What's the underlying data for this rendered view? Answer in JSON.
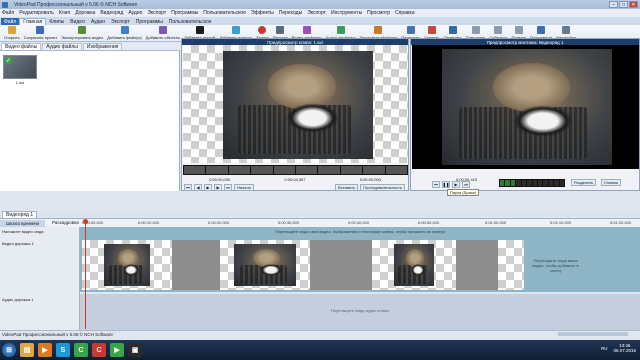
{
  "window": {
    "title": "VideoPad Профессиональный v 5.06 © NCH Software"
  },
  "menu": [
    "Файл",
    "Редактировать",
    "Клип",
    "Дорожка",
    "Видеоряд",
    "Аудио",
    "Экспорт",
    "Программы",
    "Пользовательское",
    "Эффекты",
    "Переходы",
    "Экспорт",
    "Инструменты",
    "Просмотр",
    "Справка"
  ],
  "ribbon_tabs": [
    "Файл",
    "Главная",
    "Клипы",
    "Видео",
    "Аудио",
    "Экспорт",
    "Программы",
    "Пользовательское"
  ],
  "ribbon_buttons": [
    {
      "label": "Открыть",
      "icon": "folder-icon",
      "color": "#d8a636"
    },
    {
      "label": "Сохранить проект",
      "icon": "save-icon",
      "color": "#3b6db0"
    },
    {
      "label": "Экспортировать видео",
      "icon": "export-icon",
      "color": "#5a8c3a"
    },
    {
      "label": "Добавить файл(ы)",
      "icon": "add-file-icon",
      "color": "#3d7fc9"
    },
    {
      "label": "Добавить объекты",
      "icon": "add-objects-icon",
      "color": "#7a5bb0"
    },
    {
      "label": "Добавить пустой",
      "icon": "blank-clip-icon",
      "color": "#1b1b1b"
    },
    {
      "label": "Добавить плашку",
      "icon": "title-icon",
      "color": "#3aa0c9"
    },
    {
      "label": "Запись",
      "icon": "record-icon",
      "color": "#c93b32"
    },
    {
      "label": "Рассказ",
      "icon": "narrate-icon",
      "color": "#5b6b80"
    },
    {
      "label": "Видео эффекты",
      "icon": "video-effects-icon",
      "color": "#9c4fb6"
    },
    {
      "label": "Аудио эффекты",
      "icon": "audio-effects-icon",
      "color": "#3b9c5e"
    },
    {
      "label": "Текстовые эффекты",
      "icon": "text-effects-icon",
      "color": "#c77a2e"
    },
    {
      "label": "Переходы",
      "icon": "transitions-icon",
      "color": "#4673b0"
    },
    {
      "label": "Удалить",
      "icon": "delete-icon",
      "color": "#c24a3c"
    },
    {
      "label": "Отменить",
      "icon": "undo-icon",
      "color": "#3467a8"
    },
    {
      "label": "Повторить",
      "icon": "redo-icon",
      "color": "#8a9bb0"
    },
    {
      "label": "Субтитры",
      "icon": "subtitles-icon",
      "color": "#8a9bb0"
    },
    {
      "label": "Пример",
      "icon": "preview-icon",
      "color": "#8a9bb0"
    },
    {
      "label": "Поделиться",
      "icon": "share-icon",
      "color": "#3b6db0"
    },
    {
      "label": "Настройки",
      "icon": "settings-icon",
      "color": "#6a7a8e"
    }
  ],
  "bin": {
    "tabs": [
      "Видео файлы",
      "Аудио файлы",
      "Изображения"
    ],
    "clip_label": "1.avi"
  },
  "clip_preview": {
    "title": "Предпросмотр клипа: 1.avi",
    "times": [
      "0:00:00,000",
      "0:00:04,967",
      "0:00:00,000"
    ],
    "buttons": {
      "start": "Начало",
      "insert": "Вставить",
      "seq": "Последовательность"
    }
  },
  "seq_preview": {
    "title": "Предпросмотр монтажа: Видеоряд 1",
    "time": "0:00:00,415",
    "tooltip": "Пауза (Space)",
    "right_buttons": [
      "Разделить",
      "Снимок"
    ]
  },
  "timeline": {
    "tab": "Видеоряд 1",
    "subtabs": [
      "Шкала времени",
      "Раскадровка"
    ],
    "ruler": [
      "0:00:00,000",
      "0:00:10,000",
      "0:00:20,000",
      "0:00:30,000",
      "0:00:40,000",
      "0:00:50,000",
      "0:01:00,000",
      "0:01:10,000",
      "0:01:20,000"
    ],
    "overlay_track_label": "Наложите видео сюда",
    "video_track_label": "Видео дорожка 1",
    "audio_track_label": "Аудио дорожка 1",
    "video_hint": "Перетащите сюда свои видео, изображения и текстовые клипы, чтобы наложить их поверх",
    "drop_hint": "Перетащите сюда ваши видео, чтобы добавить в конец",
    "audio_hint": "Перетащите сюда аудио клипы"
  },
  "status": "VideoPad Профессиональный v 5.06 © NCH Software",
  "taskbar": {
    "lang": "RU",
    "time": "13:46",
    "date": "06.07.2016"
  }
}
